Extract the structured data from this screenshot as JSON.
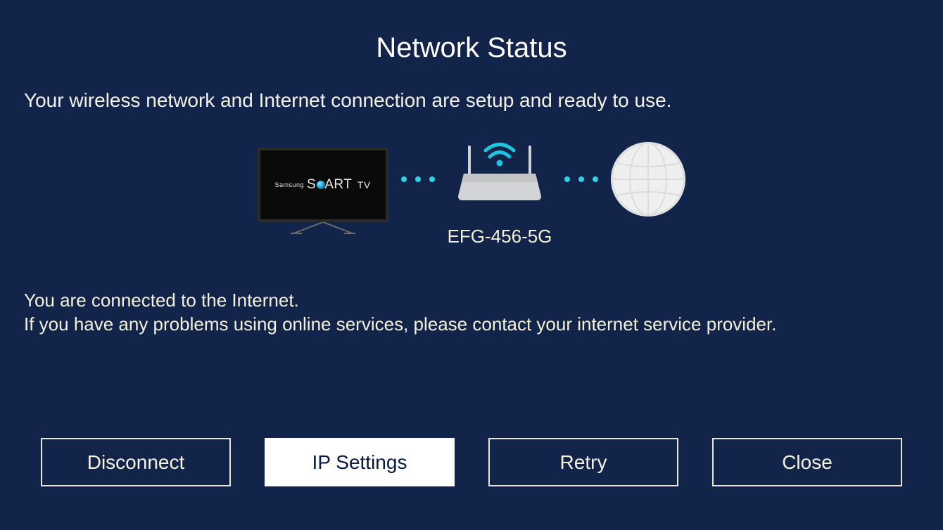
{
  "title": "Network Status",
  "subtitle": "Your wireless network and Internet connection are setup and ready to use.",
  "tv": {
    "brand": "Samsung",
    "model_pre": "S",
    "model_post": "ART",
    "model_suffix": "TV"
  },
  "network_name": "EFG-456-5G",
  "status_line1": "You are connected to the Internet.",
  "status_line2": "If you have any problems using online services, please contact your internet service provider.",
  "buttons": {
    "disconnect": "Disconnect",
    "ip_settings": "IP Settings",
    "retry": "Retry",
    "close": "Close"
  },
  "icons": {
    "tv": "tv-icon",
    "router": "router-icon",
    "wifi": "wifi-icon",
    "globe": "globe-icon"
  }
}
